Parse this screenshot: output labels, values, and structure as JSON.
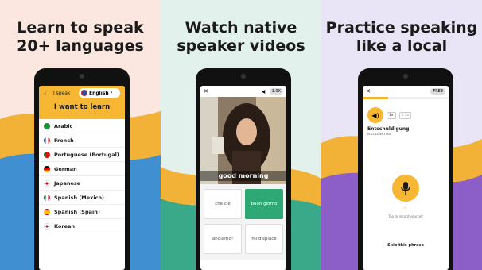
{
  "panels": [
    {
      "headline_line1": "Learn to speak",
      "headline_line2": "20+ languages"
    },
    {
      "headline_line1": "Watch native",
      "headline_line2": "speaker videos"
    },
    {
      "headline_line1": "Practice speaking",
      "headline_line2": "like a local"
    }
  ],
  "screen1": {
    "back_icon": "back-arrow-icon",
    "i_speak_label": "I speak",
    "speak_language": "English",
    "title": "I want to learn",
    "languages": [
      "Arabic",
      "French",
      "Portuguese (Portugal)",
      "German",
      "Japanese",
      "Spanish (Mexico)",
      "Spanish (Spain)",
      "Korean"
    ]
  },
  "screen2": {
    "close_symbol": "✕",
    "speed_label": "1.0X",
    "caption": "good morning",
    "choices": [
      "che c'è",
      "buon giorno",
      "andiamo!",
      "mi dispiace"
    ]
  },
  "screen3": {
    "close_symbol": "✕",
    "badge": "FREE",
    "progress": 0.3,
    "speed_1x": "1x",
    "speed_slow": "0.5x",
    "phrase": "Entschuldigung",
    "translation": "excuse me",
    "tap_hint": "Tap to record yourself",
    "skip_label": "Skip this phrase"
  },
  "colors": {
    "accent_yellow": "#f7b733",
    "panel1_bg": "#fbe7df",
    "panel2_bg": "#e3f1ec",
    "panel3_bg": "#e9e4f6",
    "correct_green": "#2ea874"
  }
}
